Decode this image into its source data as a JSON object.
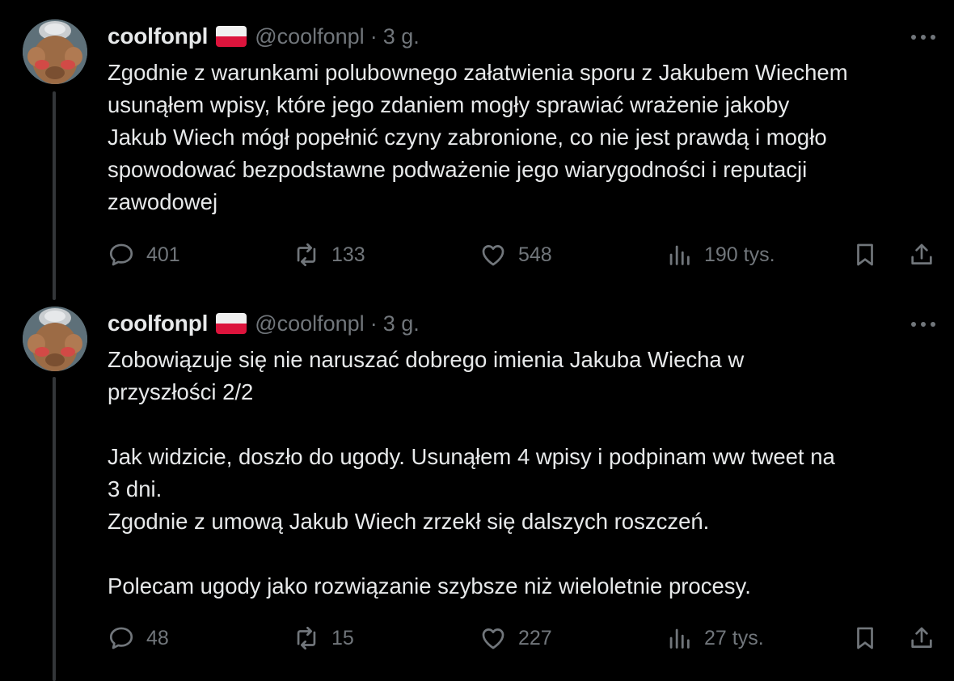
{
  "tweets": [
    {
      "name": "coolfonpl",
      "handle": "@coolfonpl",
      "separator": "·",
      "time": "3 g.",
      "text": [
        "Zgodnie z warunkami polubownego załatwienia sporu z Jakubem Wiechem",
        "usunąłem wpisy, które jego zdaniem mogły sprawiać wrażenie jakoby",
        "Jakub Wiech mógł popełnić czyny zabronione, co nie jest prawdą i mogło",
        "spowodować bezpodstawne podważenie jego wiarygodności i reputacji",
        "zawodowej"
      ],
      "replies": "401",
      "reposts": "133",
      "likes": "548",
      "views": "190 tys."
    },
    {
      "name": "coolfonpl",
      "handle": "@coolfonpl",
      "separator": "·",
      "time": "3 g.",
      "text": [
        "Zobowiązuje się nie naruszać dobrego imienia Jakuba Wiecha w",
        "przyszłości 2/2",
        "",
        "Jak widzicie, doszło do ugody. Usunąłem 4 wpisy i podpinam ww tweet na",
        "3 dni.",
        "Zgodnie z umową Jakub Wiech zrzekł się dalszych roszczeń.",
        "",
        "Polecam ugody jako rozwiązanie szybsze niż wieloletnie procesy."
      ],
      "replies": "48",
      "reposts": "15",
      "likes": "227",
      "views": "27 tys."
    }
  ],
  "icons": {
    "reply": "reply-icon",
    "repost": "repost-icon",
    "like": "heart-icon",
    "views": "views-icon",
    "bookmark": "bookmark-icon",
    "share": "share-icon",
    "more": "more-icon",
    "flag": "poland-flag-icon"
  },
  "colors": {
    "background": "#000000",
    "text": "#e7e9ea",
    "secondary": "#71767b",
    "thread_line": "#333639"
  }
}
